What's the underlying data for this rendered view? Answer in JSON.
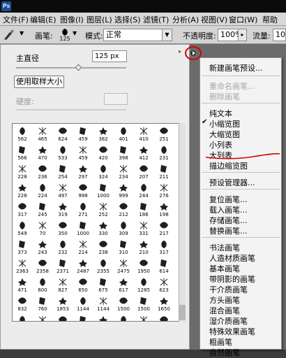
{
  "app": {
    "logo": "Ps"
  },
  "menubar": [
    "文件(F)",
    "编辑(E)",
    "图像(I)",
    "图层(L)",
    "选择(S)",
    "滤镜(T)",
    "分析(A)",
    "视图(V)",
    "窗口(W)",
    "帮助"
  ],
  "options": {
    "brush_label": "画笔:",
    "brush_size": "125",
    "mode_label": "模式:",
    "mode_value": "正常",
    "opacity_label": "不透明度:",
    "opacity_value": "100%",
    "flow_label": "流量:",
    "flow_value": "100"
  },
  "panel": {
    "master_diameter_label": "主直径",
    "master_diameter_value": "125 px",
    "use_sample_size": "使用取样大小",
    "hardness_label": "硬度:"
  },
  "brushes": [
    [
      "562",
      "465",
      "624",
      "459",
      "382",
      "401",
      "410",
      "251"
    ],
    [
      "566",
      "470",
      "533",
      "459",
      "420",
      "398",
      "412",
      "231"
    ],
    [
      "228",
      "236",
      "254",
      "297",
      "324",
      "234",
      "207",
      "211"
    ],
    [
      "228",
      "224",
      "497",
      "998",
      "1000",
      "999",
      "244",
      "276"
    ],
    [
      "317",
      "245",
      "319",
      "271",
      "252",
      "212",
      "186",
      "198"
    ],
    [
      "549",
      "70",
      "350",
      "1000",
      "330",
      "309",
      "331",
      "217"
    ],
    [
      "373",
      "243",
      "232",
      "214",
      "238",
      "310",
      "210",
      "317"
    ],
    [
      "2363",
      "2358",
      "2371",
      "2487",
      "2355",
      "2475",
      "1950",
      "614"
    ],
    [
      "471",
      "600",
      "827",
      "650",
      "675",
      "617",
      "1285",
      "623"
    ],
    [
      "832",
      "760",
      "1853",
      "1144",
      "1144",
      "1500",
      "1500",
      "1650"
    ],
    [
      "1120",
      "1628",
      "1132",
      "1000",
      "1500",
      "1500",
      "1500",
      "1500"
    ],
    [
      "1115",
      "1000",
      "2500",
      "2500",
      "1500",
      "1500",
      "1500",
      "2500"
    ],
    [
      "2428",
      "899",
      "1110",
      "2356",
      "2027",
      "",
      "",
      ""
    ]
  ],
  "context_menu": {
    "group1": [
      {
        "label": "新建画笔预设...",
        "disabled": false
      }
    ],
    "group2": [
      {
        "label": "重命名画笔...",
        "disabled": true
      },
      {
        "label": "删除画笔",
        "disabled": true
      }
    ],
    "group3": [
      {
        "label": "纯文本",
        "checked": false
      },
      {
        "label": "小缩览图",
        "checked": true
      },
      {
        "label": "大缩览图",
        "checked": false
      },
      {
        "label": "小列表",
        "checked": false
      },
      {
        "label": "大列表",
        "checked": false
      },
      {
        "label": "描边缩览图",
        "checked": false
      }
    ],
    "group4": [
      {
        "label": "预设管理器..."
      }
    ],
    "group5": [
      {
        "label": "复位画笔..."
      },
      {
        "label": "载入画笔..."
      },
      {
        "label": "存储画笔..."
      },
      {
        "label": "替换画笔..."
      }
    ],
    "group6": [
      {
        "label": "书法画笔"
      },
      {
        "label": "人造材质画笔"
      },
      {
        "label": "基本画笔"
      },
      {
        "label": "带阴影的画笔"
      },
      {
        "label": "干介质画笔"
      },
      {
        "label": "方头画笔"
      },
      {
        "label": "混合画笔"
      },
      {
        "label": "湿介质画笔"
      },
      {
        "label": "特殊效果画笔"
      },
      {
        "label": "粗画笔"
      },
      {
        "label": "自然画笔"
      }
    ]
  },
  "colors": {
    "annotation_red": "#d40000",
    "menu_bg": "#f3f3f3"
  }
}
